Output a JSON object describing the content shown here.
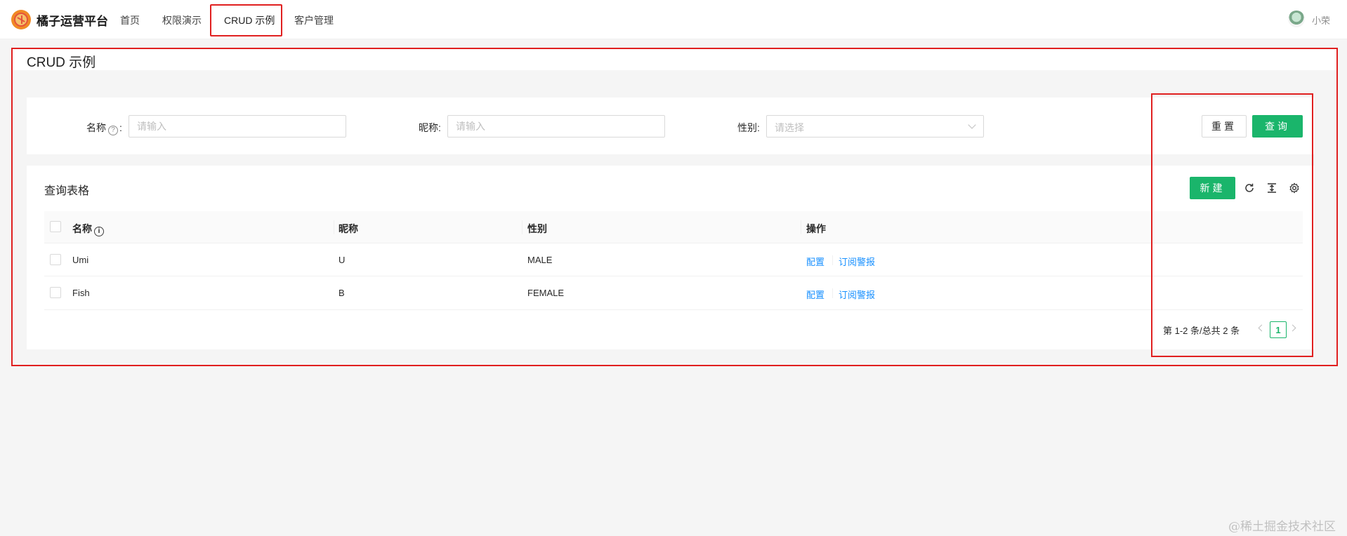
{
  "app": {
    "title": "橘子运营平台"
  },
  "nav": {
    "items": [
      {
        "label": "首页"
      },
      {
        "label": "权限演示"
      },
      {
        "label": "CRUD 示例"
      },
      {
        "label": "客户管理"
      }
    ],
    "active_index": 2
  },
  "user": {
    "name": "小荣"
  },
  "page": {
    "title": "CRUD 示例"
  },
  "search": {
    "fields": [
      {
        "label": "名称",
        "has_help": true,
        "placeholder": "请输入",
        "value": ""
      },
      {
        "label": "昵称",
        "placeholder": "请输入",
        "value": ""
      },
      {
        "label": "性别",
        "placeholder": "请选择",
        "type": "select"
      }
    ],
    "reset_label": "重置",
    "query_label": "查询"
  },
  "table": {
    "title": "查询表格",
    "new_label": "新建",
    "toolbar_icons": [
      "reload-icon",
      "density-icon",
      "settings-icon"
    ],
    "columns": [
      "名称",
      "昵称",
      "性别",
      "操作"
    ],
    "rows": [
      {
        "name": "Umi",
        "nickname": "U",
        "gender": "MALE",
        "actions": [
          "配置",
          "订阅警报"
        ]
      },
      {
        "name": "Fish",
        "nickname": "B",
        "gender": "FEMALE",
        "actions": [
          "配置",
          "订阅警报"
        ]
      }
    ]
  },
  "pagination": {
    "total_text": "第 1-2 条/总共 2 条",
    "current_page": "1"
  },
  "watermark": "@稀土掘金技术社区",
  "colors": {
    "primary": "#1ab56b",
    "link": "#1890ff",
    "highlight": "#e02020"
  }
}
